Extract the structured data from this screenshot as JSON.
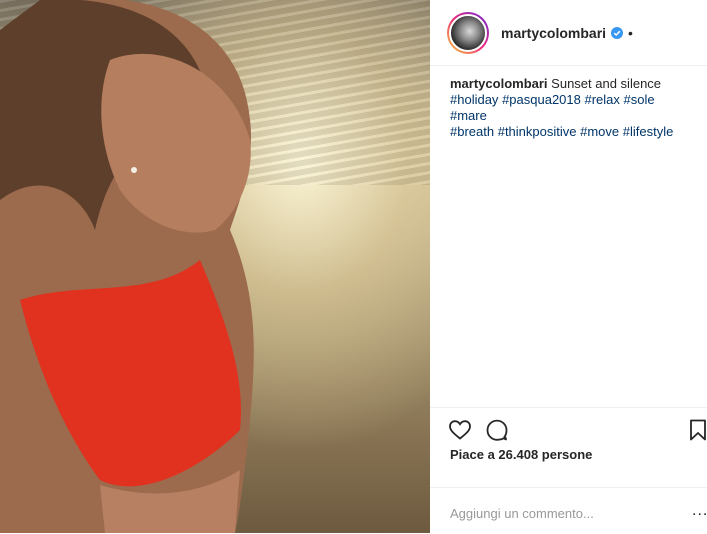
{
  "post": {
    "username": "martycolombari",
    "verified": true,
    "separator": "•",
    "caption": {
      "username": "martycolombari",
      "text": "Sunset and silence",
      "hashtags": [
        "#holiday",
        "#pasqua2018",
        "#relax",
        "#sole",
        "#mare",
        "#breath",
        "#thinkpositive",
        "#move",
        "#lifestyle"
      ]
    },
    "likes_text": "Piace a 26.408 persone",
    "comment_placeholder": "Aggiungi un commento...",
    "more_label": "..."
  },
  "colors": {
    "hashtag": "#003569",
    "verified_badge": "#3897f0",
    "text": "#262626",
    "placeholder": "#999999"
  },
  "icons": [
    "heart-icon",
    "comment-icon",
    "bookmark-icon",
    "verified-badge-icon"
  ]
}
